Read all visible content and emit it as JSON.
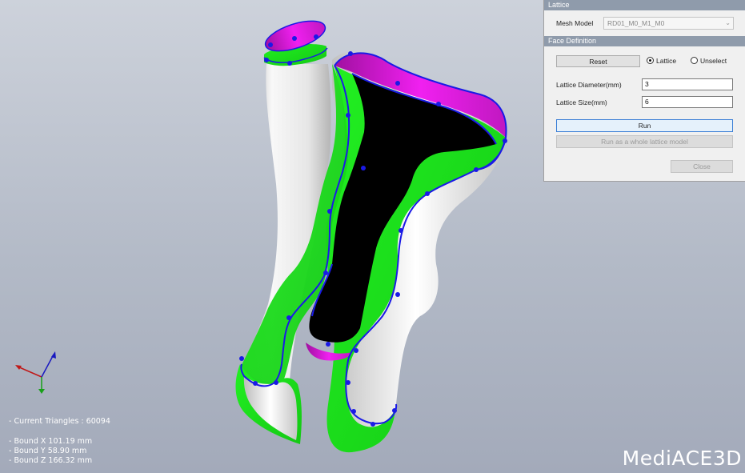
{
  "panel": {
    "title": "Lattice",
    "mesh_model_label": "Mesh Model",
    "mesh_model_value": "RD01_M0_M1_M0",
    "face_definition_header": "Face Definition",
    "reset_label": "Reset",
    "radio_lattice_label": "Lattice",
    "radio_unselect_label": "Unselect",
    "selected_mode": "Lattice",
    "lattice_diameter_label": "Lattice Diameter(mm)",
    "lattice_diameter_value": "3",
    "lattice_size_label": "Lattice Size(mm)",
    "lattice_size_value": "6",
    "run_label": "Run",
    "run_whole_label": "Run as a whole lattice model",
    "close_label": "Close"
  },
  "info": {
    "triangles": "- Current Triangles : 60094",
    "bound_x": "- Bound X   101.19 mm",
    "bound_y": "- Bound Y   58.90 mm",
    "bound_z": "- Bound Z   166.32 mm"
  },
  "brand": "MediACE3D",
  "colors": {
    "background": "#bfc5d0",
    "model_surface": "#ededed",
    "lattice_band": "#1ee61e",
    "cut_face": "#e015e0",
    "hole": "#000000",
    "boundary_curve": "#1a1ae6",
    "panel_header": "#8f9bab"
  },
  "icons": [
    "axis-triad-icon",
    "dropdown-arrow-icon"
  ]
}
